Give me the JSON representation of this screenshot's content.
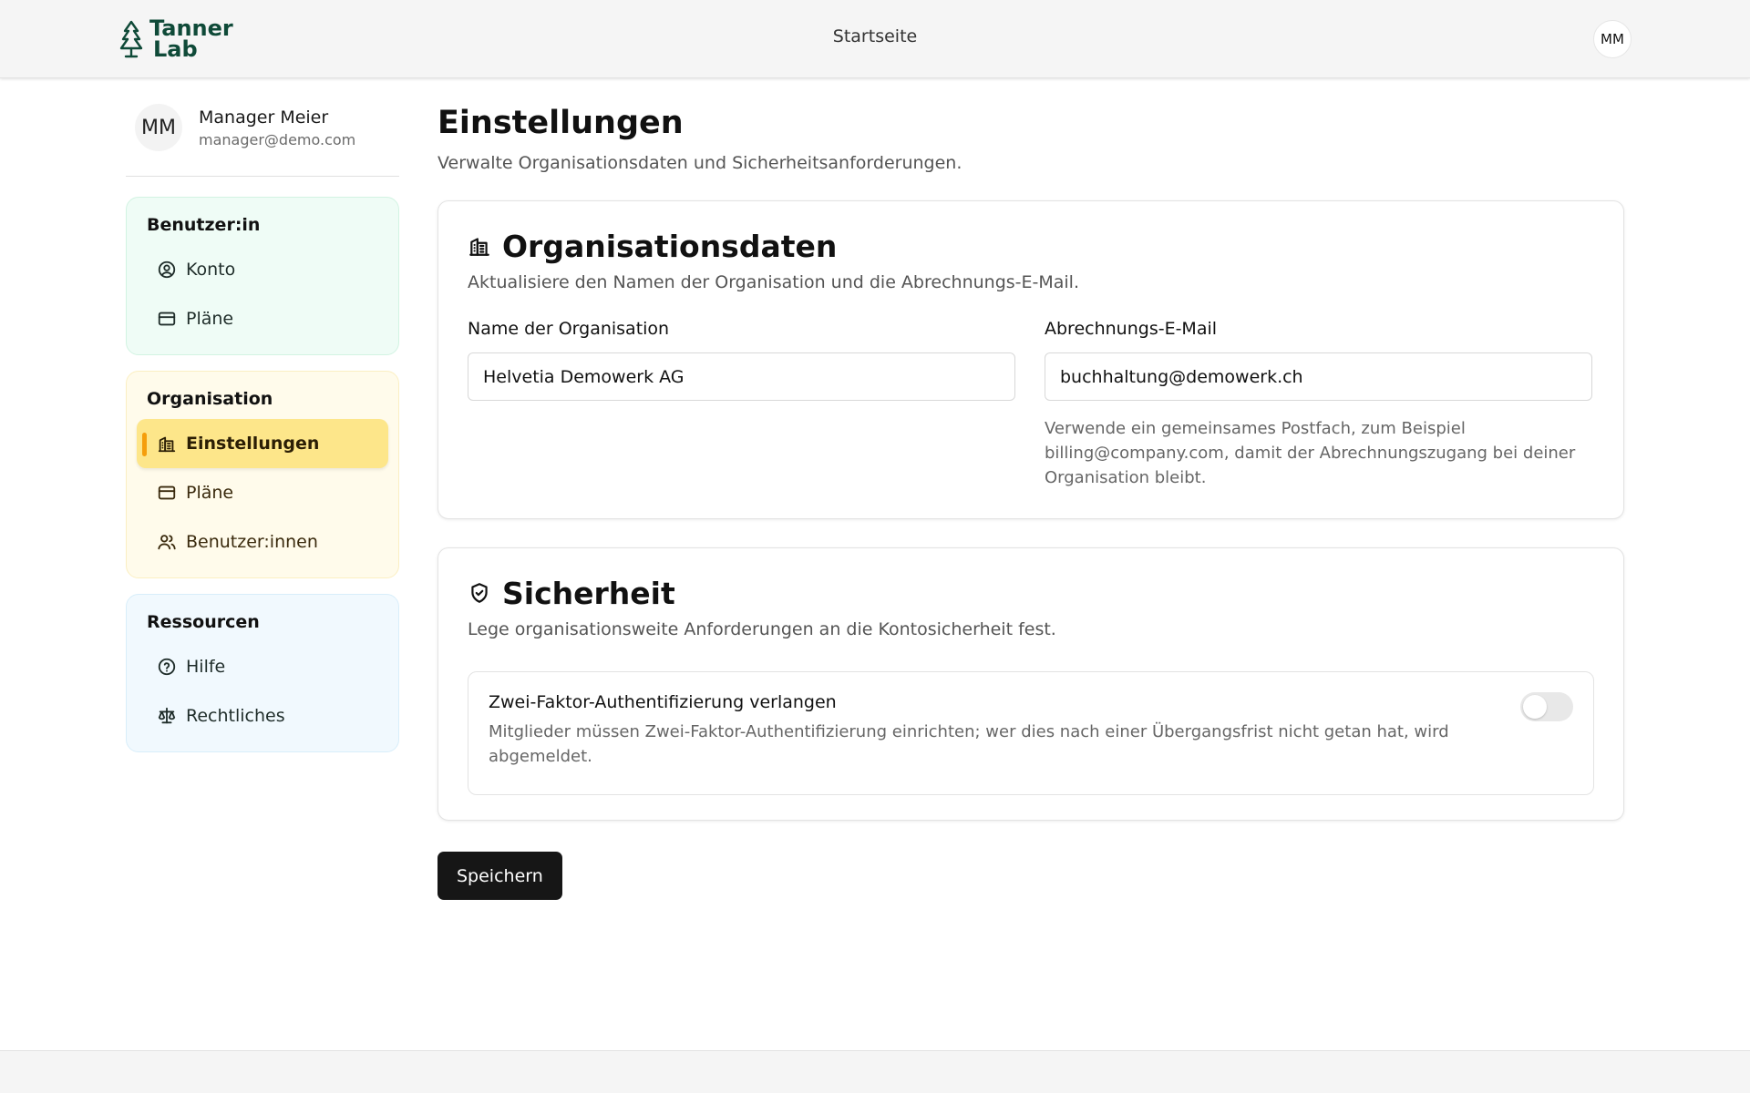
{
  "header": {
    "logo_line1": "Tanner",
    "logo_line2": "Lab",
    "nav_home": "Startseite",
    "avatar_initials": "MM"
  },
  "profile": {
    "initials": "MM",
    "name": "Manager Meier",
    "email": "manager@demo.com"
  },
  "sidebar": {
    "groups": [
      {
        "title": "Benutzer:in",
        "items": [
          {
            "label": "Konto",
            "icon": "user-circle-icon"
          },
          {
            "label": "Pläne",
            "icon": "credit-card-icon"
          }
        ]
      },
      {
        "title": "Organisation",
        "items": [
          {
            "label": "Einstellungen",
            "icon": "building-icon",
            "active": true
          },
          {
            "label": "Pläne",
            "icon": "credit-card-icon"
          },
          {
            "label": "Benutzer:innen",
            "icon": "users-icon"
          }
        ]
      },
      {
        "title": "Ressourcen",
        "items": [
          {
            "label": "Hilfe",
            "icon": "help-circle-icon"
          },
          {
            "label": "Rechtliches",
            "icon": "scale-icon"
          }
        ]
      }
    ]
  },
  "main": {
    "title": "Einstellungen",
    "description": "Verwalte Organisationsdaten und Sicherheitsanforderungen.",
    "org_card": {
      "title": "Organisationsdaten",
      "description": "Aktualisiere den Namen der Organisation und die Abrechnungs-E-Mail.",
      "name_label": "Name der Organisation",
      "name_value": "Helvetia Demowerk AG",
      "email_label": "Abrechnungs-E-Mail",
      "email_value": "buchhaltung@demowerk.ch",
      "email_hint": "Verwende ein gemeinsames Postfach, zum Beispiel billing@company.com, damit der Abrechnungszugang bei deiner Organisation bleibt."
    },
    "security_card": {
      "title": "Sicherheit",
      "description": "Lege organisationsweite Anforderungen an die Kontosicherheit fest.",
      "twofa_title": "Zwei-Faktor-Authentifizierung verlangen",
      "twofa_description": "Mitglieder müssen Zwei-Faktor-Authentifizierung einrichten; wer dies nach einer Übergangsfrist nicht getan hat, wird abgemeldet.",
      "twofa_enabled": false
    },
    "save_label": "Speichern"
  },
  "colors": {
    "brand": "#0f4a38",
    "active_item_bg": "#fde68a",
    "active_indicator": "#f59e0b",
    "primary_button": "#161616"
  }
}
